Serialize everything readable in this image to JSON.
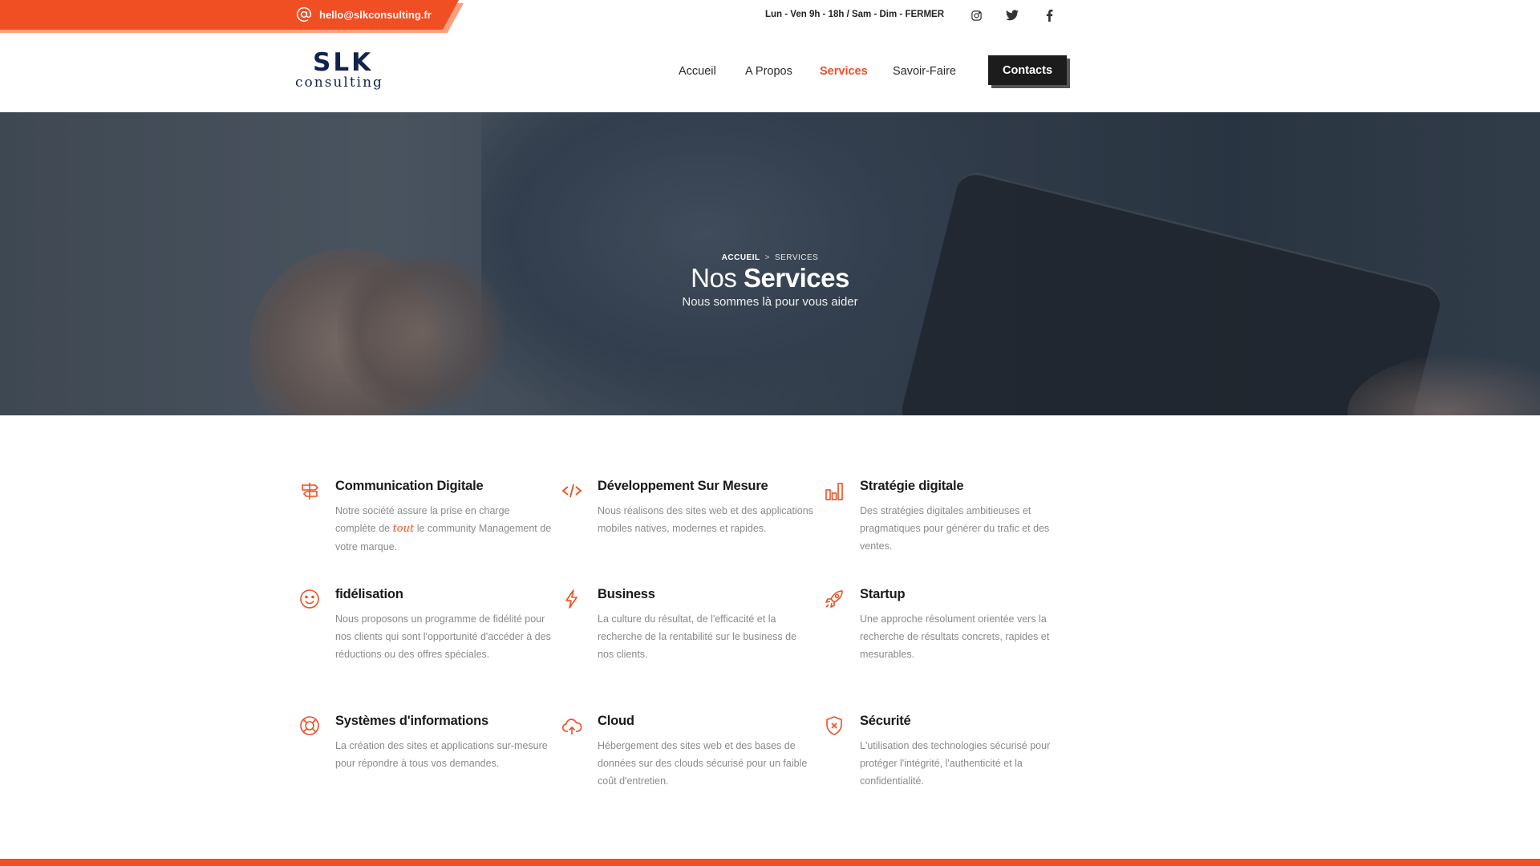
{
  "topbar": {
    "email": "hello@slkconsulting.fr",
    "hours": "Lun - Ven 9h - 18h / Sam - Dim - FERMER",
    "social": [
      "instagram-icon",
      "twitter-icon",
      "facebook-icon"
    ]
  },
  "header": {
    "logo_main": "SLK",
    "logo_sub": "consulting",
    "nav": {
      "accueil": "Accueil",
      "apropos": "A Propos",
      "services": "Services",
      "savoirfaire": "Savoir-Faire",
      "contacts": "Contacts"
    }
  },
  "hero": {
    "breadcrumb_home": "ACCUEIL",
    "breadcrumb_sep": ">",
    "breadcrumb_current": "SERVICES",
    "title_light": "Nos",
    "title_bold": "Services",
    "subtitle": "Nous sommes là pour vous aider"
  },
  "services": [
    {
      "icon": "signpost-icon",
      "title": "Communication Digitale",
      "desc_before": "Notre société assure la prise en charge complète de ",
      "desc_highlight": "tout",
      "desc_after": " le community Management de votre marque."
    },
    {
      "icon": "code-icon",
      "title": "Développement Sur Mesure",
      "desc": "Nous réalisons des sites web et des applications mobiles natives, modernes et rapides."
    },
    {
      "icon": "bar-chart-icon",
      "title": "Stratégie digitale",
      "desc": "Des stratégies digitales ambitieuses et pragmatiques pour générer du trafic et des ventes."
    },
    {
      "icon": "smiley-icon",
      "title": "fidélisation",
      "desc": "Nous proposons un programme de fidélité pour nos clients qui sont l'opportunité d'accéder à des réductions ou des offres spéciales."
    },
    {
      "icon": "lightning-icon",
      "title": "Business",
      "desc": "La culture du résultat, de l'efficacité et la recherche de la rentabilité sur le business de nos clients."
    },
    {
      "icon": "rocket-icon",
      "title": "Startup",
      "desc": "Une approche résolument orientée vers la recherche de résultats concrets, rapides et mesurables."
    },
    {
      "icon": "lifebuoy-icon",
      "title": "Systèmes d'informations",
      "desc": "La création des sites et applications sur-mesure pour répondre à tous vos demandes."
    },
    {
      "icon": "cloud-upload-icon",
      "title": "Cloud",
      "desc": "Hébergement des sites web et des bases de données sur des clouds sécurisé pour un faible coût d'entretien."
    },
    {
      "icon": "shield-icon",
      "title": "Sécurité",
      "desc": "L'utilisation des technologies sécurisé pour protéger l'intégrité, l'authenticité et la confidentialité."
    }
  ],
  "colors": {
    "accent": "#f04e23",
    "dark": "#1c1c1c",
    "logo": "#12234b"
  }
}
